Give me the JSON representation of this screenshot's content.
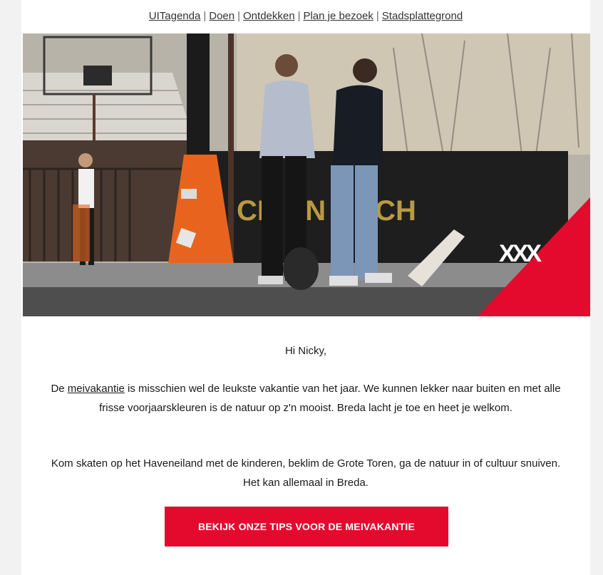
{
  "nav": {
    "items": [
      "UITagenda",
      "Doen",
      "Ontdekken",
      "Plan je bezoek",
      "Stadsplattegrond"
    ],
    "separator": "|"
  },
  "hero": {
    "wall_text": "CR  AN  RACH",
    "logo": "XXX",
    "colors": {
      "accent": "#e30a2e",
      "cone": "#e8641e"
    }
  },
  "body": {
    "greeting": "Hi Nicky,",
    "para1_before": "De ",
    "para1_link": "meivakantie",
    "para1_after": " is misschien wel de leukste vakantie van het jaar. We kunnen lekker naar buiten en met alle frisse voorjaarskleuren is de natuur op z'n mooist. Breda lacht je toe en heet je welkom.",
    "para2": "Kom skaten op het Haveneiland met de kinderen, beklim de Grote Toren, ga de natuur in of cultuur snuiven. Het kan allemaal in Breda.",
    "cta_label": "BEKIJK ONZE TIPS VOOR DE MEIVAKANTIE"
  }
}
